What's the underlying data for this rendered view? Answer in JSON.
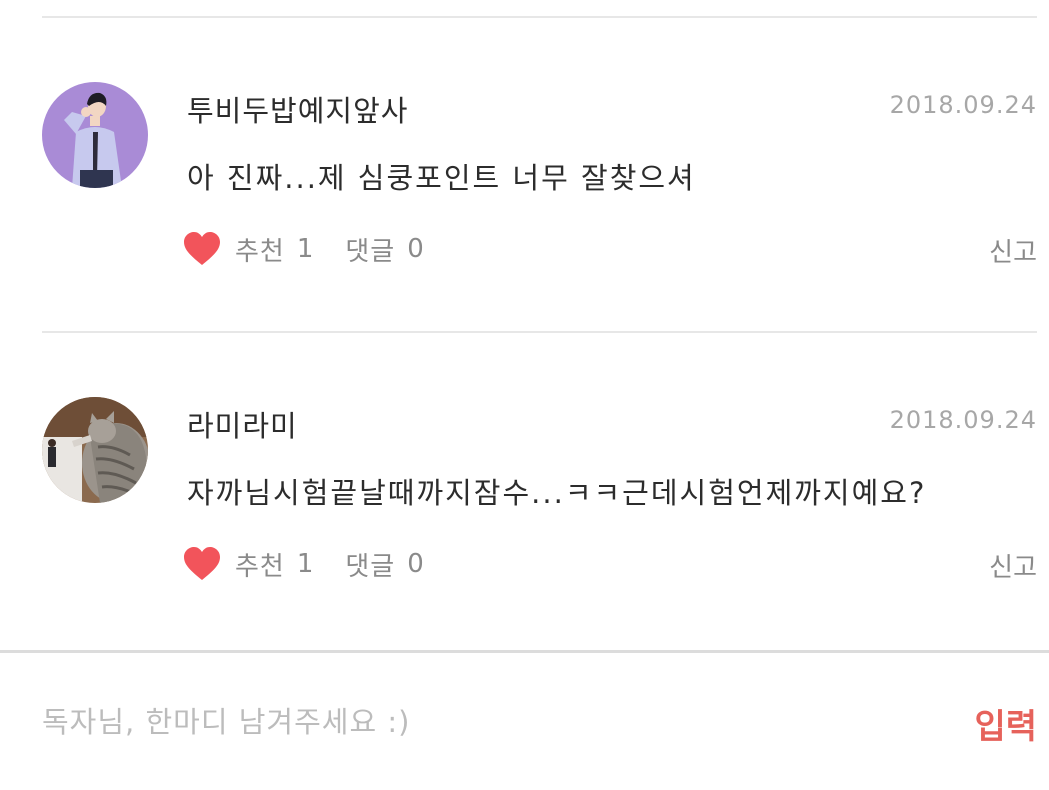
{
  "comments": [
    {
      "author": "투비두밥예지앞사",
      "date": "2018.09.24",
      "text": "아 진짜...제 심쿵포인트 너무 잘찾으셔",
      "recommend_label": "추천",
      "recommend_count": "1",
      "reply_label": "댓글",
      "reply_count": "0",
      "report_label": "신고",
      "avatar_icon": "cartoon-person-avatar-icon"
    },
    {
      "author": "라미라미",
      "date": "2018.09.24",
      "text": "자까님시험끝날때까지잠수...ㅋㅋ근데시험언제까지예요?",
      "recommend_label": "추천",
      "recommend_count": "1",
      "reply_label": "댓글",
      "reply_count": "0",
      "report_label": "신고",
      "avatar_icon": "cat-photo-avatar-icon"
    }
  ],
  "input_bar": {
    "placeholder": "독자님, 한마디 남겨주세요 :)",
    "value": "",
    "submit_label": "입력"
  },
  "colors": {
    "heart": "#f2545b",
    "submit": "#e6625b",
    "avatar_1_bg": "#a98bd6",
    "divider": "#e7e7e7"
  }
}
